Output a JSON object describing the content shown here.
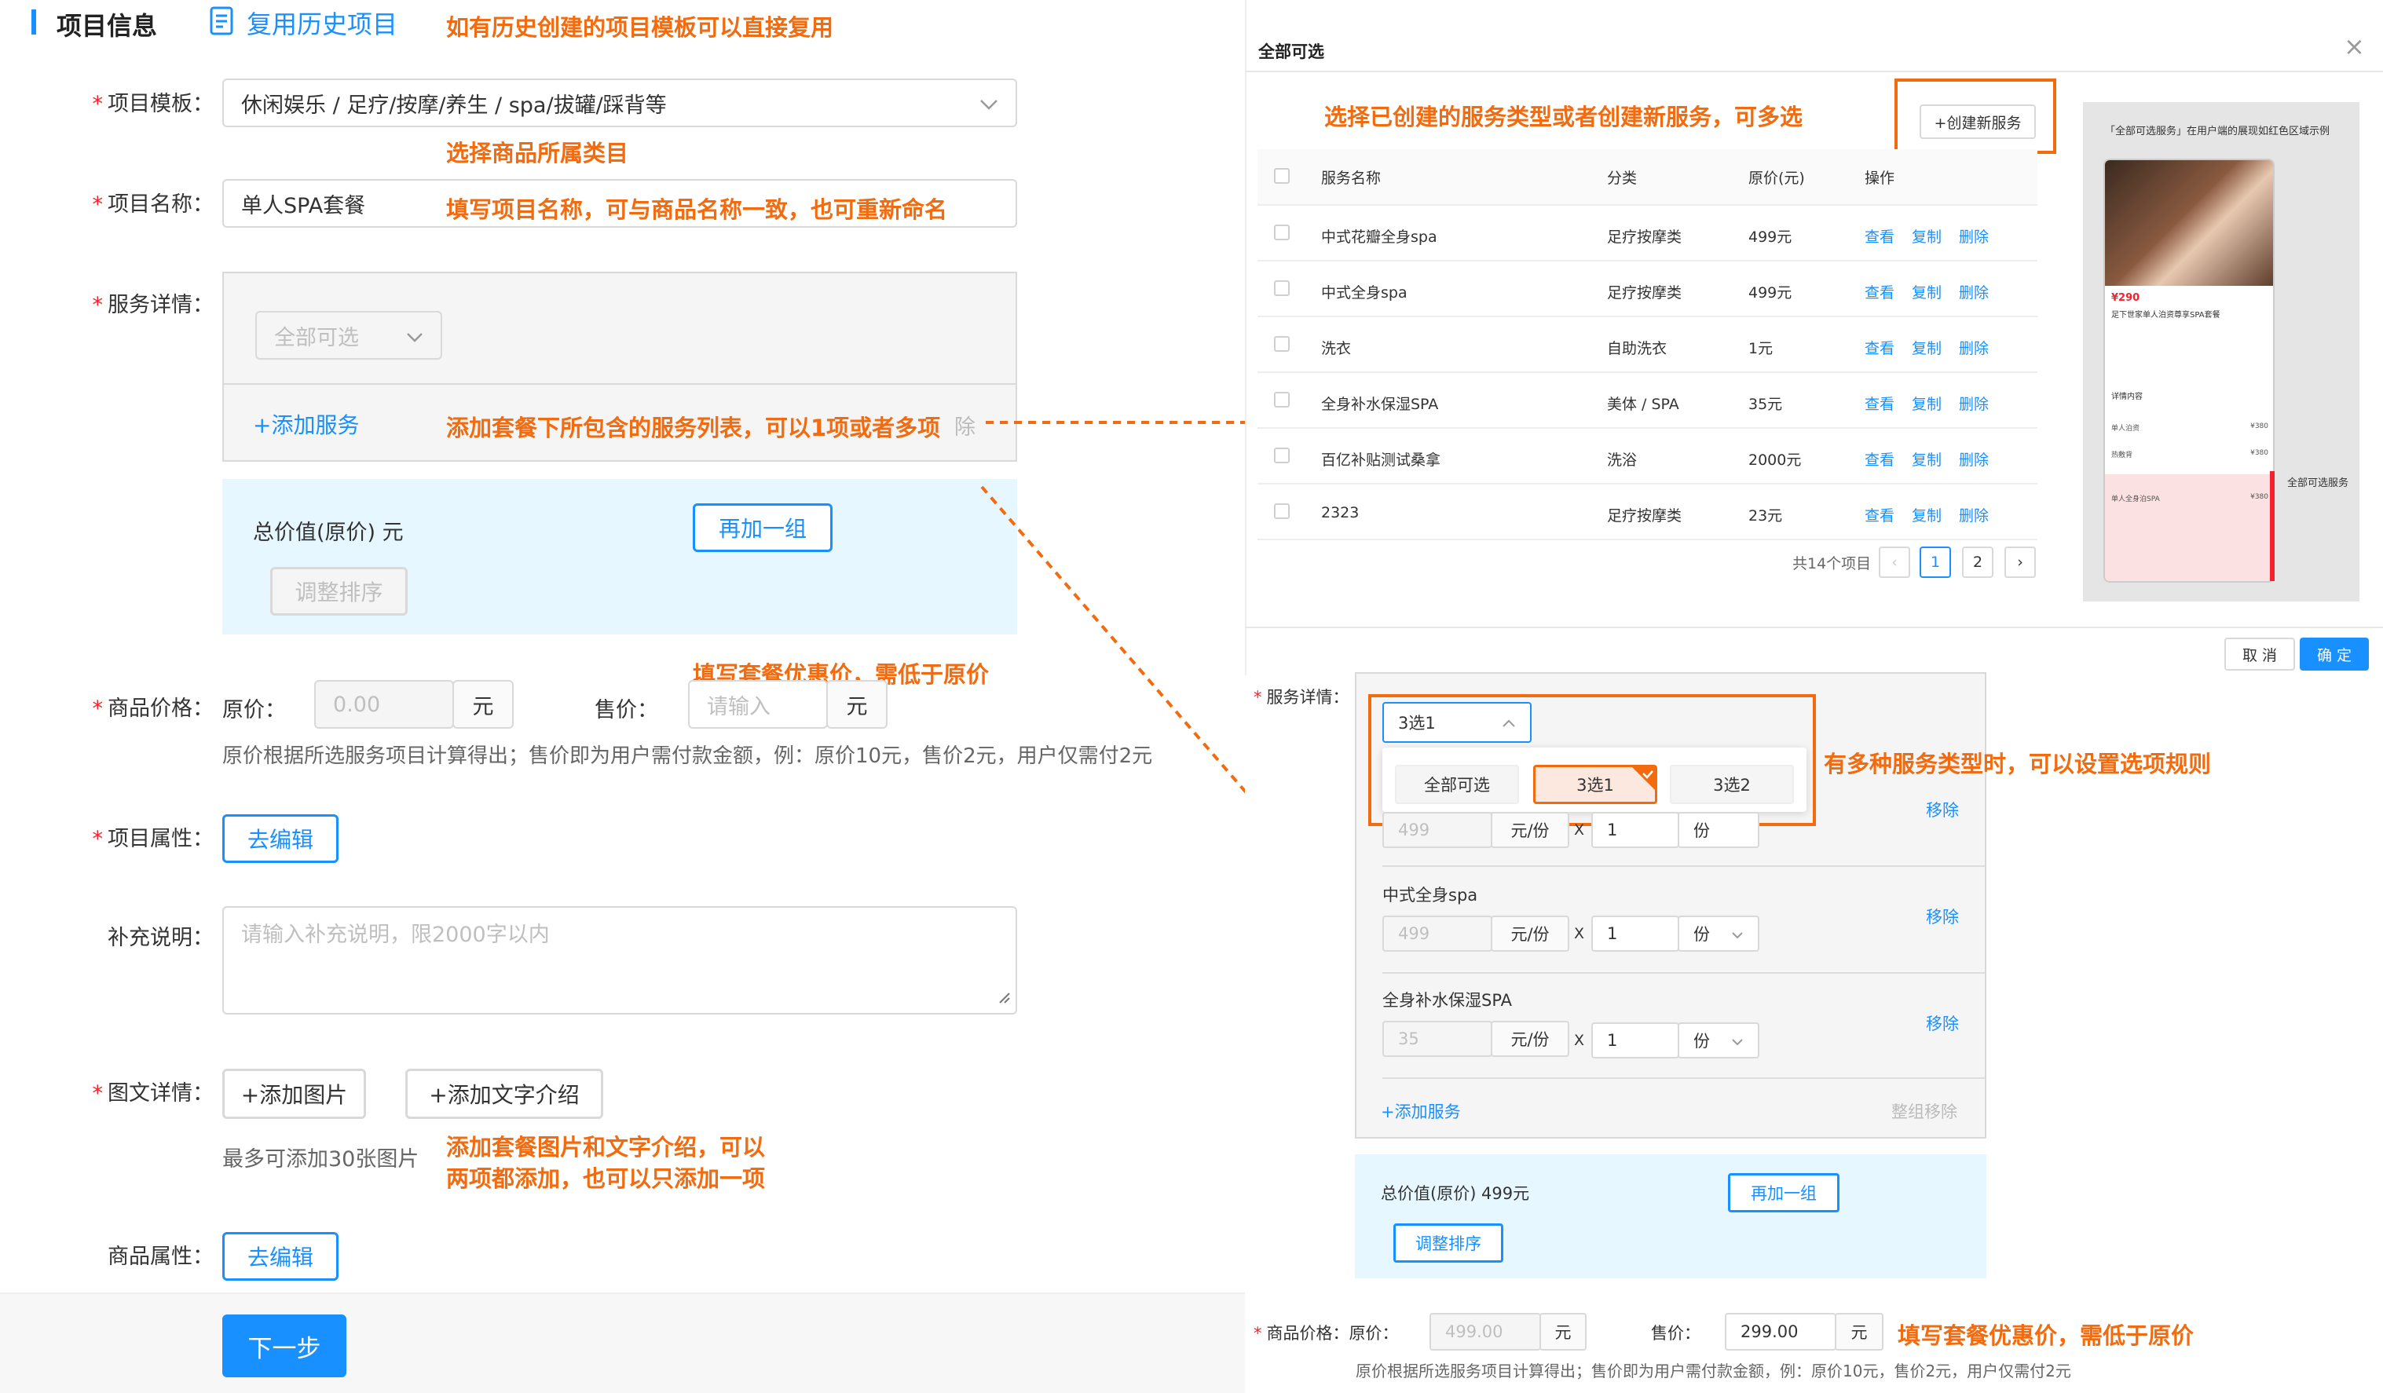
{
  "left": {
    "section_title": "项目信息",
    "reuse_link": "复用历史项目",
    "note_reuse": "如有历史创建的项目模板可以直接复用",
    "template": {
      "label": "项目模板：",
      "value": "休闲娱乐 / 足疗/按摩/养生 / spa/拔罐/踩背等"
    },
    "note_category": "选择商品所属类目",
    "name": {
      "label": "项目名称：",
      "value": "单人SPA套餐"
    },
    "note_name": "填写项目名称，可与商品名称一致，也可重新命名",
    "service": {
      "label": "服务详情：",
      "select_value": "全部可选",
      "add_service": "+添加服务",
      "remove_text": "除"
    },
    "note_service": "添加套餐下所包含的服务列表，可以1项或者多项",
    "group": {
      "total": "总价值(原价) 元",
      "add_group": "再加一组",
      "sort": "调整排序"
    },
    "note_price": "填写套餐优惠价，需低于原价",
    "price": {
      "label": "商品价格：",
      "orig_label": "原价：",
      "orig_placeholder": "0.00",
      "unit": "元",
      "sale_label": "售价：",
      "sale_placeholder": "请输入",
      "hint": "原价根据所选服务项目计算得出；售价即为用户需付款金额，例：原价10元，售价2元，用户仅需付2元"
    },
    "attr": {
      "label": "项目属性：",
      "button": "去编辑"
    },
    "extra": {
      "label": "补充说明：",
      "placeholder": "请输入补充说明，限2000字以内"
    },
    "graphic": {
      "label": "图文详情：",
      "add_image": "+添加图片",
      "add_text": "+添加文字介绍",
      "hint": "最多可添加30张图片"
    },
    "note_graphic_1": "添加套餐图片和文字介绍，可以",
    "note_graphic_2": "两项都添加，也可以只添加一项",
    "goods_attr": {
      "label": "商品属性：",
      "button": "去编辑"
    },
    "next": "下一步"
  },
  "modal": {
    "title": "全部可选",
    "close": "×",
    "note_create": "选择已创建的服务类型或者创建新服务，可多选",
    "create_button": "+创建新服务",
    "columns": [
      "服务名称",
      "分类",
      "原价(元)",
      "操作"
    ],
    "rows": [
      {
        "name": "中式花瓣全身spa",
        "category": "足疗按摩类",
        "price": "499元"
      },
      {
        "name": "中式全身spa",
        "category": "足疗按摩类",
        "price": "499元"
      },
      {
        "name": "洗衣",
        "category": "自助洗衣",
        "price": "1元"
      },
      {
        "name": "全身补水保湿SPA",
        "category": "美体 / SPA",
        "price": "35元"
      },
      {
        "name": "百亿补贴测试桑拿",
        "category": "洗浴",
        "price": "2000元"
      },
      {
        "name": "2323",
        "category": "足疗按摩类",
        "price": "23元"
      }
    ],
    "ops": {
      "view": "查看",
      "copy": "复制",
      "delete": "删除"
    },
    "total": "共14个项目",
    "pages": [
      "1",
      "2"
    ],
    "prev": "‹",
    "next": "›",
    "cancel": "取 消",
    "ok": "确 定",
    "preview": {
      "caption": "「全部可选服务」在用户端的展现如红色区域示例",
      "side_label": "全部可选服务",
      "price": "¥290",
      "title": "足下世家单人泊资尊享SPA套餐",
      "section": "详情内容",
      "item1": "单人泊资",
      "item2": "热敷背",
      "item3": "单人全身泊SPA",
      "p1": "¥380",
      "p2": "¥380",
      "p3": "¥380"
    }
  },
  "right": {
    "service_label": "服务详情：",
    "rule_select": "3选1",
    "rule_options": [
      "全部可选",
      "3选1",
      "3选2"
    ],
    "note_rule": "有多种服务类型时，可以设置选项规则",
    "items": [
      {
        "name": "",
        "price": "499",
        "unit": "元/份",
        "x": "X",
        "qty": "1",
        "qty_unit": "份",
        "remove": "移除"
      },
      {
        "name": "中式全身spa",
        "price": "499",
        "unit": "元/份",
        "x": "X",
        "qty": "1",
        "qty_unit": "份",
        "remove": "移除"
      },
      {
        "name": "全身补水保湿SPA",
        "price": "35",
        "unit": "元/份",
        "x": "X",
        "qty": "1",
        "qty_unit": "份",
        "remove": "移除"
      }
    ],
    "add_service": "+添加服务",
    "group_remove": "整组移除",
    "total": "总价值(原价) 499元",
    "add_group": "再加一组",
    "sort": "调整排序",
    "price_label": "商品价格：",
    "orig_label": "原价：",
    "orig_value": "499.00",
    "unit": "元",
    "sale_label": "售价：",
    "sale_value": "299.00",
    "note_price": "填写套餐优惠价，需低于原价",
    "hint": "原价根据所选服务项目计算得出；售价即为用户需付款金额，例：原价10元，售价2元，用户仅需付2元"
  },
  "colors": {
    "primary": "#1890ff",
    "annotation": "#f26b0f",
    "required": "#f5222d"
  }
}
